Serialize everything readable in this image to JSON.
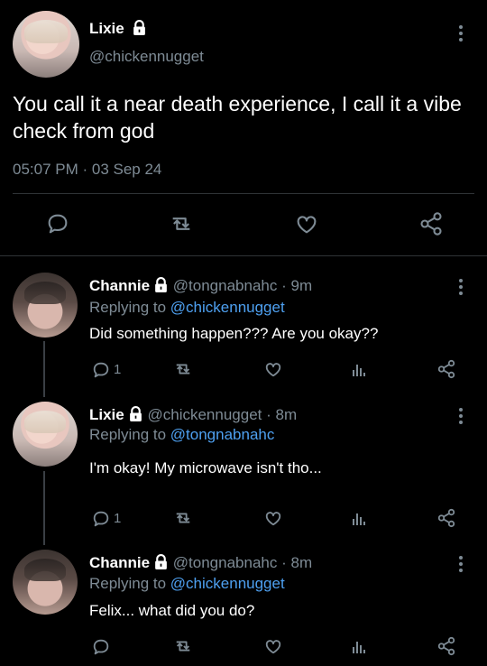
{
  "main_tweet": {
    "author_name": "Lixie",
    "handle": "@chickennugget",
    "text": "You call it a near death experience, I call it a vibe check from god",
    "timestamp": "05:07 PM · 03 Sep 24"
  },
  "replies": [
    {
      "author_name": "Channie",
      "handle": "@tongnabnahc",
      "age": "· 9m",
      "replying_prefix": "Replying to",
      "replying_to": "@chickennugget",
      "text": "Did something happen??? Are you okay??",
      "reply_count": "1"
    },
    {
      "author_name": "Lixie",
      "handle": "@chickennugget",
      "age": "· 8m",
      "replying_prefix": "Replying to",
      "replying_to": "@tongnabnahc",
      "text": "I'm okay! My microwave isn't tho...",
      "reply_count": "1"
    },
    {
      "author_name": "Channie",
      "handle": "@tongnabnahc",
      "age": "· 8m",
      "replying_prefix": "Replying to",
      "replying_to": "@chickennugget",
      "text": "Felix... what did you do?",
      "reply_count": ""
    }
  ],
  "colors": {
    "background": "#000000",
    "text": "#e7e9ea",
    "muted": "#7e8b95",
    "link": "#4ea0f0",
    "divider": "#2f3336"
  },
  "icons": [
    "lock-icon",
    "more-icon",
    "reply-icon",
    "retweet-icon",
    "like-icon",
    "share-icon",
    "views-icon"
  ]
}
